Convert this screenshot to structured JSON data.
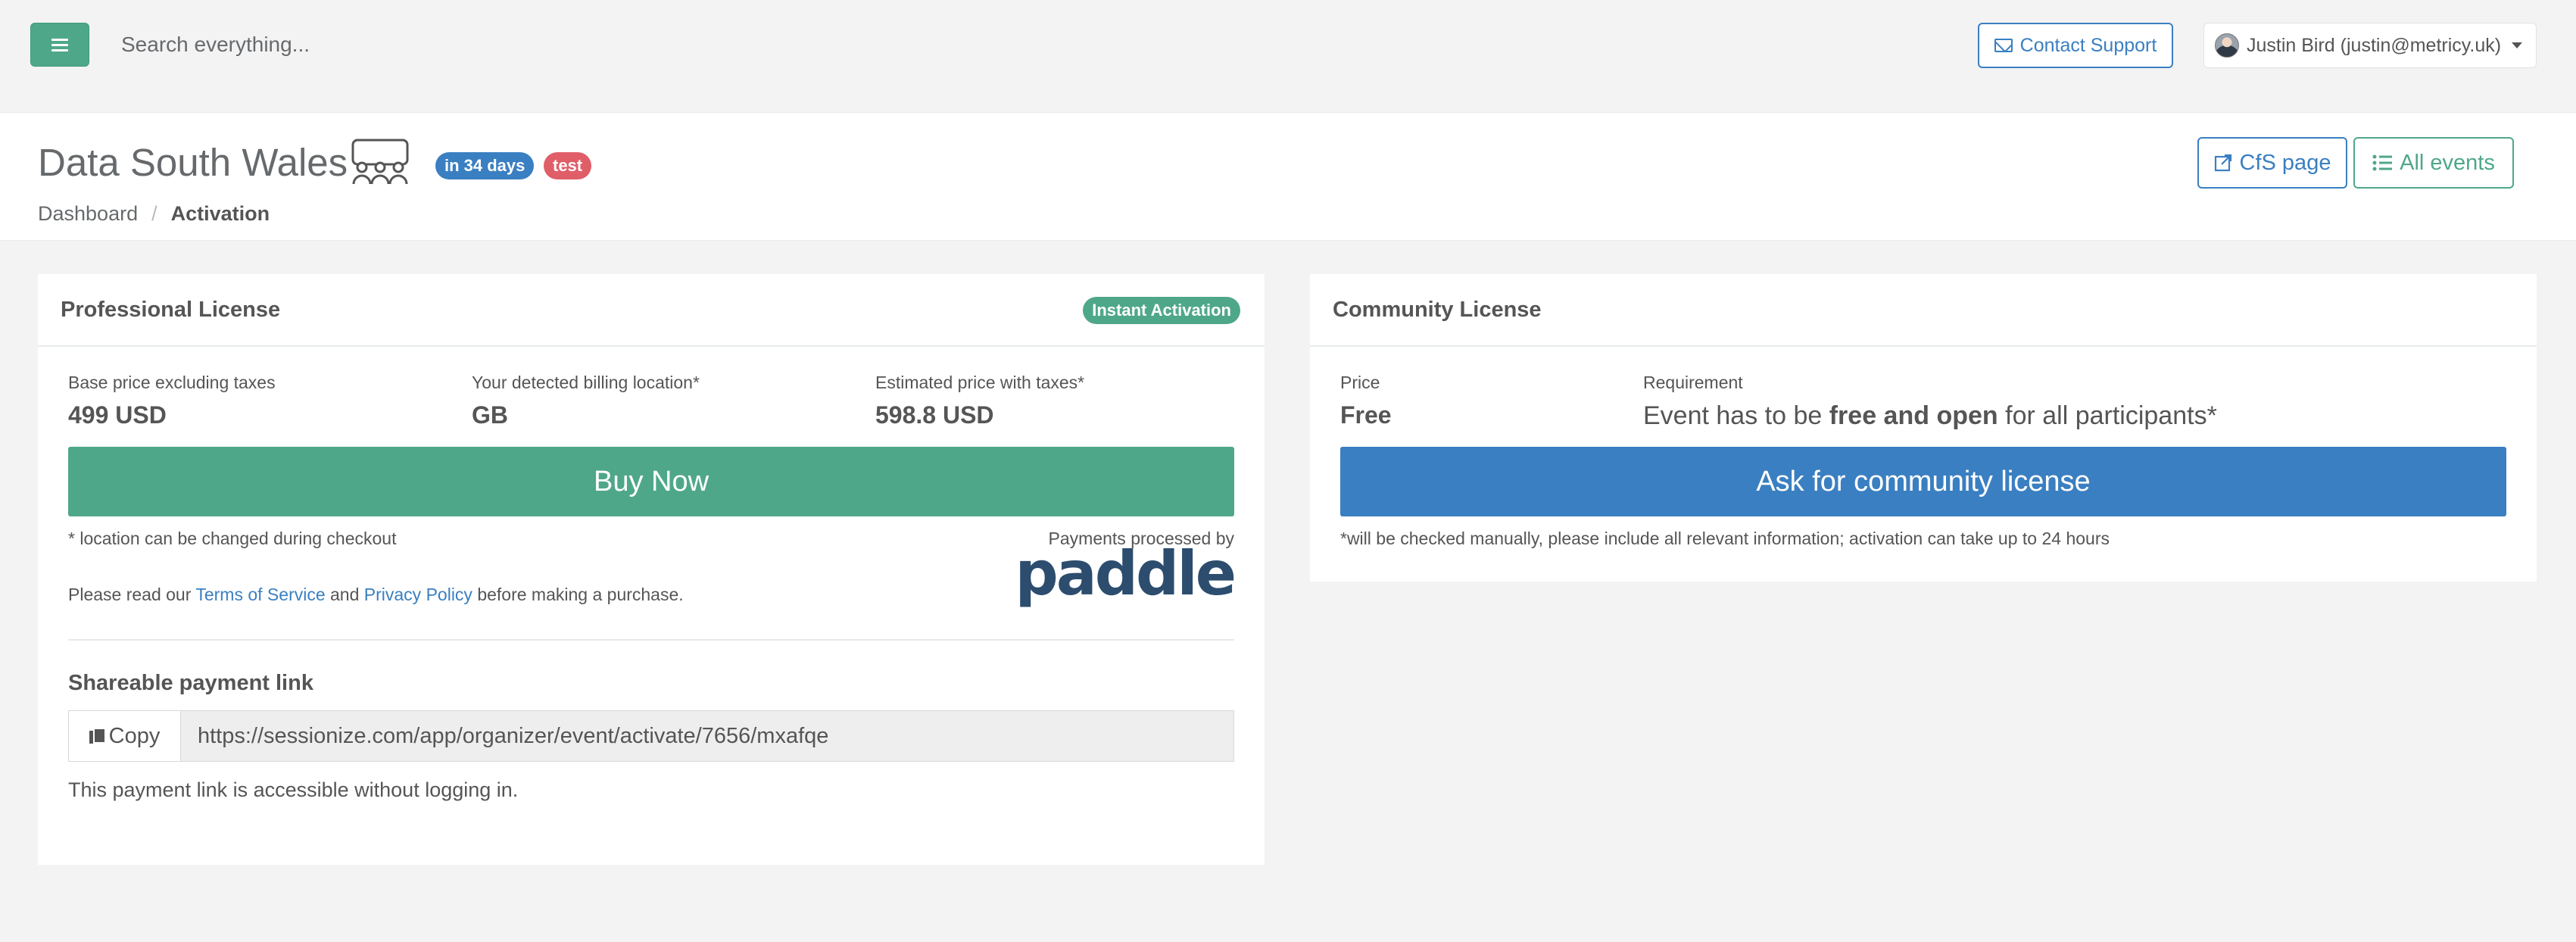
{
  "topbar": {
    "search_placeholder": "Search everything...",
    "contact_support": "Contact Support",
    "user_label": "Justin Bird (justin@metricy.uk)"
  },
  "heading": {
    "event_title": "Data South Wales",
    "badge_days": "in 34 days",
    "badge_test": "test",
    "breadcrumb": {
      "root": "Dashboard",
      "separator": "/",
      "current": "Activation"
    },
    "cfs_button": "CfS page",
    "events_button": "All events"
  },
  "professional": {
    "title": "Professional License",
    "badge": "Instant Activation",
    "base_price_label": "Base price excluding taxes",
    "base_price_value": "499 USD",
    "location_label": "Your detected billing location*",
    "location_value": "GB",
    "estimated_label": "Estimated price with taxes*",
    "estimated_value": "598.8 USD",
    "buy_button": "Buy Now",
    "location_note": "* location can be changed during checkout",
    "payments_label": "Payments processed by",
    "paddle_logo": "paddle",
    "terms_prefix": "Please read our ",
    "terms_link": "Terms of Service",
    "terms_and": " and ",
    "privacy_link": "Privacy Policy",
    "terms_suffix": " before making a purchase.",
    "share_title": "Shareable payment link",
    "copy_button": "Copy",
    "payment_link": "https://sessionize.com/app/organizer/event/activate/7656/mxafqe",
    "link_note": "This payment link is accessible without logging in."
  },
  "community": {
    "title": "Community License",
    "price_label": "Price",
    "price_value": "Free",
    "requirement_label": "Requirement",
    "req_prefix": "Event has to be ",
    "req_bold": "free and open",
    "req_suffix": " for all participants*",
    "ask_button": "Ask for community license",
    "note": "*will be checked manually, please include all relevant information; activation can take up to 24 hours"
  },
  "colors": {
    "primary_green": "#4fa78a",
    "primary_blue": "#3a7fc1",
    "danger_red": "#e05e68",
    "page_bg": "#f3f3f4"
  }
}
